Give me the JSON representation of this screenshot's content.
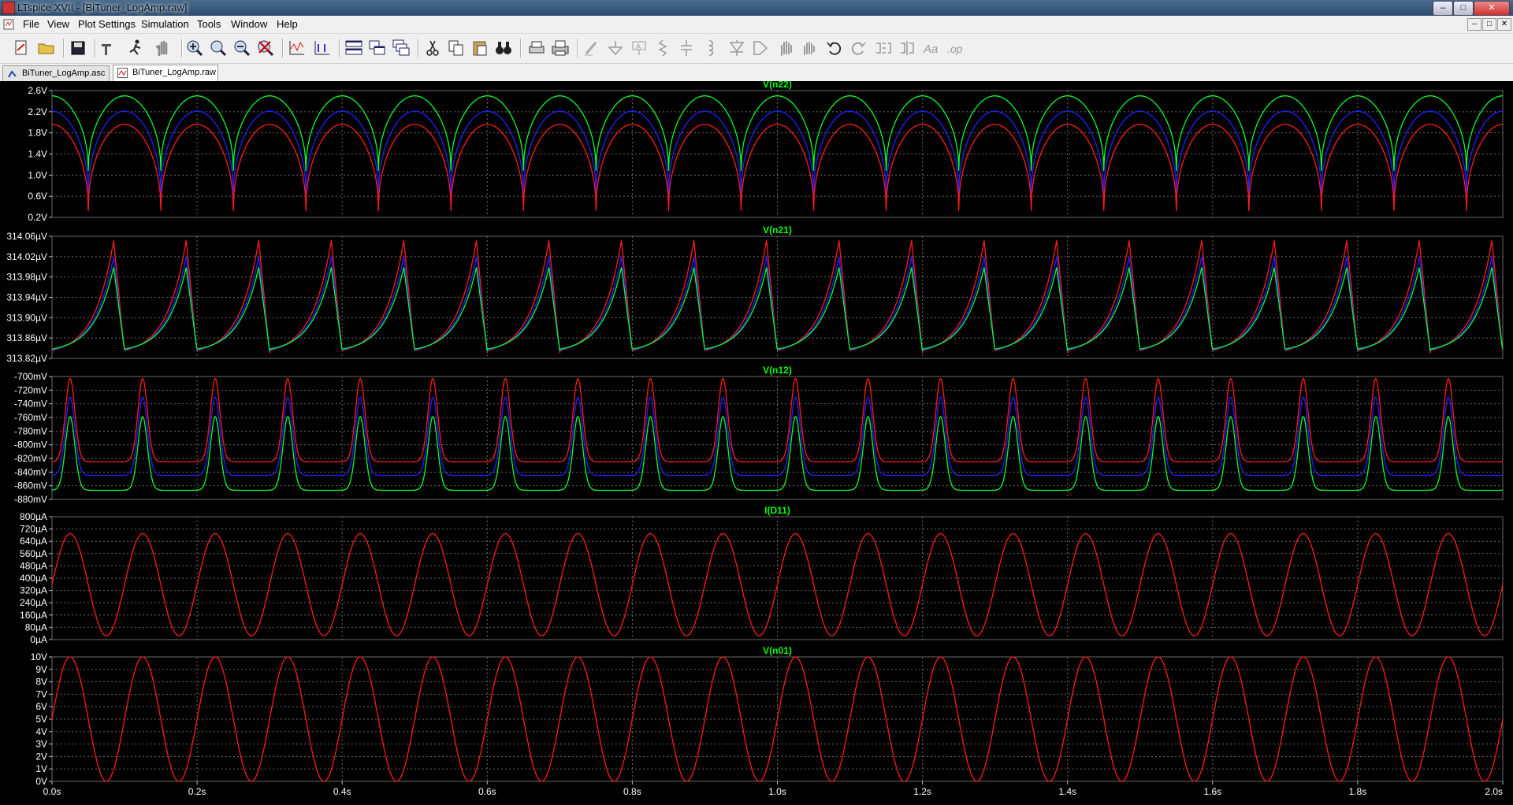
{
  "window": {
    "title": "LTspice XVII - [BiTuner_LogAmp.raw]",
    "controls": [
      "–",
      "□",
      "✕"
    ]
  },
  "menu": {
    "items": [
      "File",
      "View",
      "Plot Settings",
      "Simulation",
      "Tools",
      "Window",
      "Help"
    ]
  },
  "toolbar": {
    "buttons": [
      "new-schematic",
      "open",
      "save",
      "control-panel",
      "run",
      "halt",
      "zoom-in",
      "zoom-full",
      "zoom-out",
      "zoom-cancel",
      "autorange",
      "manual-limits",
      "tile-horizontal",
      "tile-vertical",
      "cascade",
      "cut",
      "copy",
      "paste",
      "find",
      "print-setup",
      "print",
      "wire",
      "ground",
      "label-net",
      "resistor",
      "capacitor",
      "inductor",
      "diode",
      "component",
      "move",
      "drag",
      "undo",
      "redo",
      "rotate",
      "mirror",
      "text",
      "spice-directive"
    ]
  },
  "tabs": [
    {
      "label": "BiTuner_LogAmp.asc",
      "icon": "schematic-icon",
      "active": false
    },
    {
      "label": "BiTuner_LogAmp.raw",
      "icon": "waveform-icon",
      "active": true
    }
  ],
  "colors": {
    "background": "#000000",
    "grid": "#6a6a6a",
    "trace_title": "#00ff00",
    "step1": "#ff1a1a",
    "step2": "#2020ff",
    "step3": "#00ff30"
  },
  "x_axis": {
    "min": 0,
    "max": 2.0,
    "ticks": [
      "0.0s",
      "0.2s",
      "0.4s",
      "0.6s",
      "0.8s",
      "1.0s",
      "1.2s",
      "1.4s",
      "1.6s",
      "1.8s",
      "2.0s"
    ]
  },
  "chart_data": [
    {
      "type": "line",
      "title": "V(n22)",
      "ylim": [
        0.2,
        2.6
      ],
      "yticks": [
        "2.6V",
        "2.2V",
        "1.8V",
        "1.4V",
        "1.0V",
        "0.6V",
        "0.2V"
      ],
      "shape": "rectified-dip",
      "period_s": 0.1,
      "series": [
        {
          "color": "#00ff30",
          "min": 1.08,
          "max": 2.5
        },
        {
          "color": "#2020ff",
          "min": 0.62,
          "max": 2.21
        },
        {
          "color": "#ff1a1a",
          "min": 0.32,
          "max": 1.96
        }
      ]
    },
    {
      "type": "line",
      "title": "V(n21)",
      "ylim": [
        313.82,
        314.06
      ],
      "yticks": [
        "314.06µV",
        "314.02µV",
        "313.98µV",
        "313.94µV",
        "313.90µV",
        "313.86µV",
        "313.82µV"
      ],
      "shape": "sawtooth-rise",
      "period_s": 0.1,
      "series": [
        {
          "color": "#ff1a1a",
          "min": 313.831,
          "max": 314.052
        },
        {
          "color": "#2020ff",
          "min": 313.833,
          "max": 314.02
        },
        {
          "color": "#00ff30",
          "min": 313.835,
          "max": 313.999
        }
      ]
    },
    {
      "type": "line",
      "title": "V(n12)",
      "ylim": [
        -880,
        -690
      ],
      "yticks": [
        "-700mV",
        "-720mV",
        "-740mV",
        "-760mV",
        "-780mV",
        "-800mV",
        "-820mV",
        "-840mV",
        "-860mV",
        "-880mV"
      ],
      "shape": "peaked",
      "period_s": 0.1,
      "series": [
        {
          "color": "#ff1a1a",
          "min": -822,
          "max": -693
        },
        {
          "color": "#2020ff",
          "min": -843,
          "max": -722
        },
        {
          "color": "#00ff30",
          "min": -866,
          "max": -752
        }
      ]
    },
    {
      "type": "line",
      "title": "I(D11)",
      "ylim": [
        0,
        800
      ],
      "yticks": [
        "800µA",
        "720µA",
        "640µA",
        "560µA",
        "480µA",
        "400µA",
        "320µA",
        "240µA",
        "160µA",
        "80µA",
        "0µA"
      ],
      "shape": "sine",
      "period_s": 0.1,
      "series": [
        {
          "color": "#ff1a1a",
          "min": 25,
          "max": 690
        }
      ]
    },
    {
      "type": "line",
      "title": "V(n01)",
      "ylim": [
        0,
        10
      ],
      "yticks": [
        "10V",
        "9V",
        "8V",
        "7V",
        "6V",
        "5V",
        "4V",
        "3V",
        "2V",
        "1V",
        "0V"
      ],
      "shape": "sine",
      "period_s": 0.1,
      "series": [
        {
          "color": "#ff1a1a",
          "min": 0,
          "max": 10
        }
      ]
    }
  ]
}
